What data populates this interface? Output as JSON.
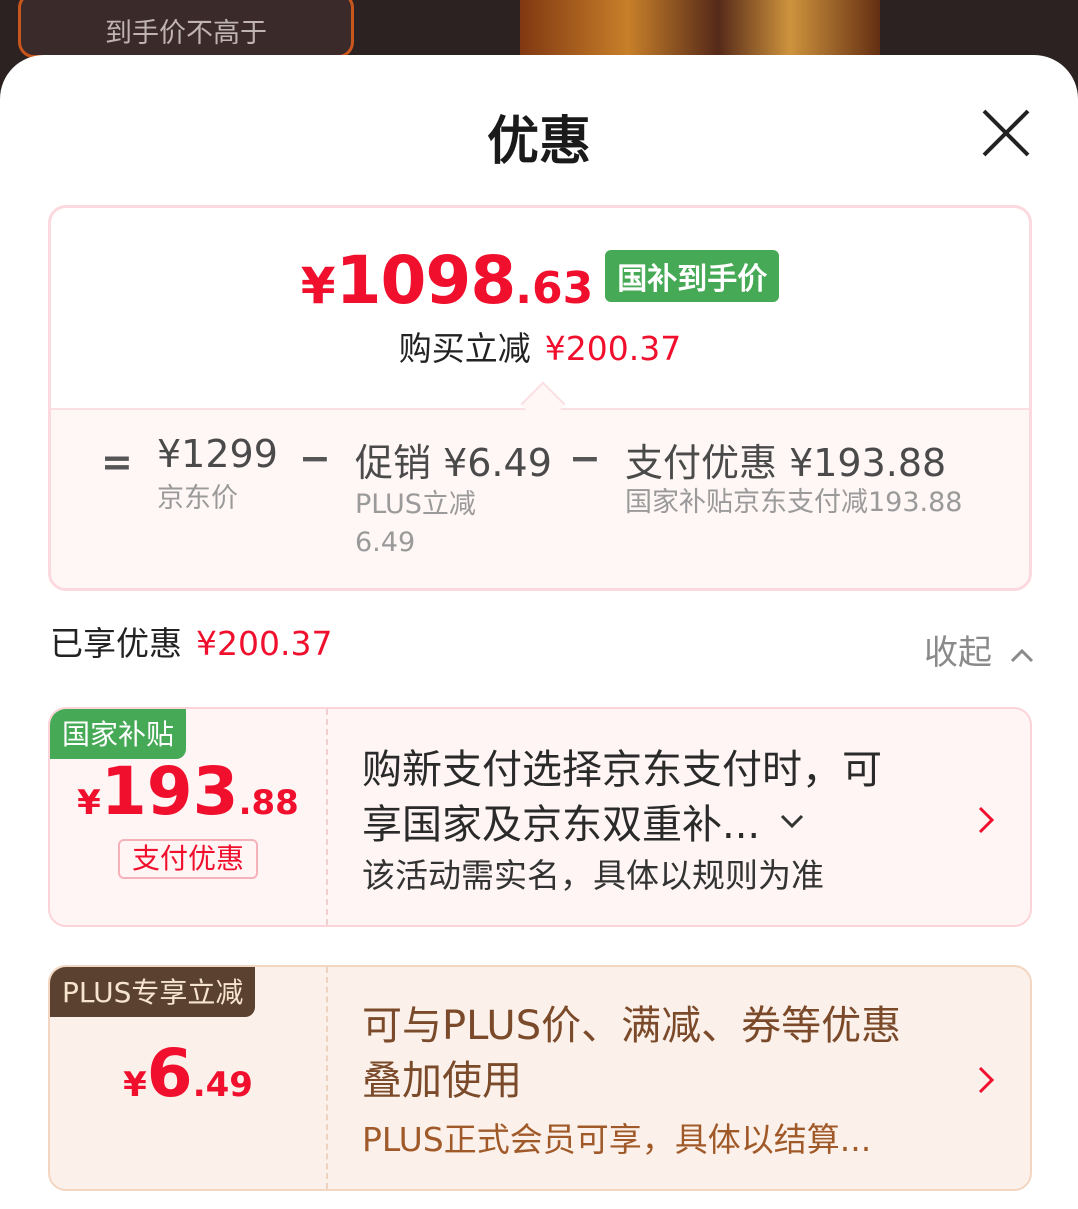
{
  "background": {
    "pill_text": "到手价不高于"
  },
  "header": {
    "title": "优惠",
    "close_icon": "close-icon"
  },
  "summary": {
    "price_symbol": "¥",
    "price_int": "1098",
    "price_dec": ".63",
    "price_tag": "国补到手价",
    "save_label": "购买立减",
    "save_amount": "¥200.37",
    "equals": "=",
    "minus1": "−",
    "minus2": "−",
    "jd_price": "¥1299",
    "jd_price_label": "京东价",
    "promo_label": "促销 ¥6.49",
    "promo_sub_1": "PLUS立减",
    "promo_sub_2": "6.49",
    "pay_label": "支付优惠 ¥193.88",
    "pay_sub": "国家补贴京东支付减193.88"
  },
  "enjoyed": {
    "label": "已享优惠",
    "amount": "¥200.37",
    "collapse": "收起",
    "collapse_icon": "chevron-up-icon"
  },
  "coupons": [
    {
      "tag": "国家补贴",
      "yen": "¥",
      "int": "193",
      "dec": ".88",
      "sub_tag": "支付优惠",
      "text_1": "购新支付选择京东支付时，可",
      "text_2": "享国家及京东双重补...",
      "note": "该活动需实名，具体以规则为准"
    },
    {
      "tag": "PLUS专享立减",
      "yen": "¥",
      "int": "6",
      "dec": ".49",
      "text_1": "可与PLUS价、满减、券等优惠",
      "text_2": "叠加使用",
      "note": "PLUS正式会员可享，具体以结算..."
    }
  ],
  "colors": {
    "red": "#f0102e",
    "green": "#45a956",
    "plus_brown": "#5b4230"
  }
}
